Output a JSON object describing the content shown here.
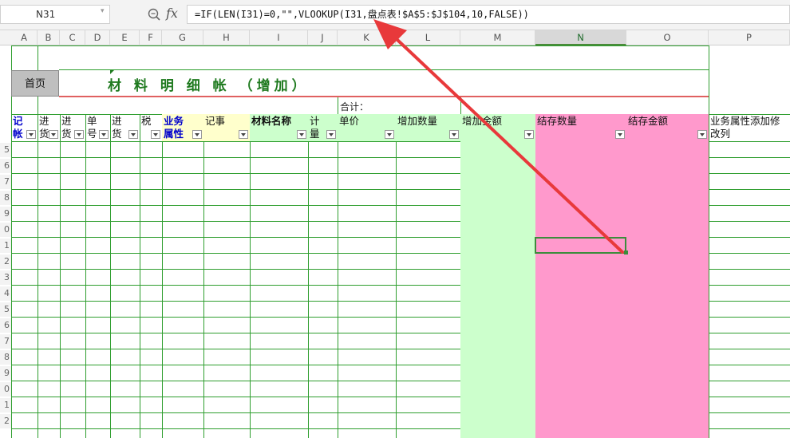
{
  "formula_bar": {
    "name_box": "N31",
    "fx_label": "fx",
    "formula": "=IF(LEN(I31)=0,\"\",VLOOKUP(I31,盘点表!$A$5:$J$104,10,FALSE))"
  },
  "columns": [
    "A",
    "B",
    "C",
    "D",
    "E",
    "F",
    "G",
    "H",
    "I",
    "J",
    "K",
    "L",
    "M",
    "N",
    "O",
    "P"
  ],
  "selected_column": "N",
  "home_button": "首页",
  "sheet_title": "材 料 明 细 帐 （增加）",
  "total_label": "合计：",
  "headers": {
    "a": "记帐月",
    "b": "进货",
    "c": "进货日",
    "d": "单号",
    "e": "进货地点",
    "f": "税",
    "g": "业务属性",
    "h": "记事",
    "i": "材料名称",
    "j": "计量单位",
    "k": "单价",
    "l": "增加数量",
    "m": "增加金额",
    "n": "结存数量",
    "o": "结存金额",
    "p": "业务属性添加修改列"
  },
  "row_numbers": [
    "5",
    "6",
    "7",
    "8",
    "9",
    "0",
    "1",
    "2",
    "3",
    "4",
    "5",
    "6",
    "7",
    "8",
    "9",
    "0",
    "1",
    "2"
  ],
  "colors": {
    "grid": "#2f9e2f",
    "title_green": "#1f7a1f",
    "header_blue": "#0000cc",
    "green_fill": "#ccffcc",
    "pink_fill": "#ff99cc",
    "yellow_fill": "#ffffcc",
    "arrow_red": "#e8393b"
  }
}
